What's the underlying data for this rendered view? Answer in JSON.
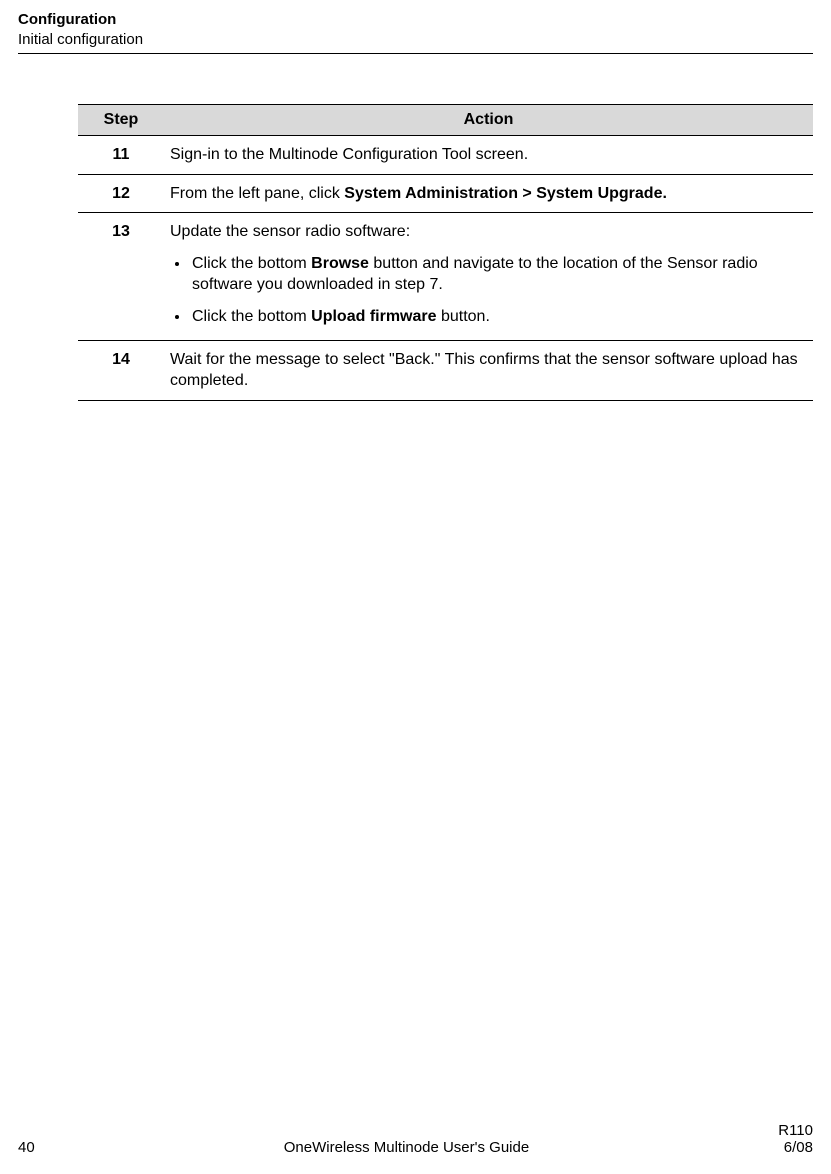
{
  "header": {
    "title": "Configuration",
    "subtitle": "Initial configuration"
  },
  "table": {
    "headers": {
      "step": "Step",
      "action": "Action"
    },
    "rows": [
      {
        "step": "11",
        "action_plain": "Sign-in to the Multinode Configuration Tool screen."
      },
      {
        "step": "12",
        "action_pre": "From the left pane, click ",
        "action_bold": "System Administration > System Upgrade."
      },
      {
        "step": "13",
        "intro": "Update the sensor radio software:",
        "bullet1_pre": "Click the bottom ",
        "bullet1_bold": "Browse",
        "bullet1_post": " button and navigate to the location of the Sensor radio software you downloaded in step 7.",
        "bullet2_pre": "Click the bottom ",
        "bullet2_bold": "Upload firmware",
        "bullet2_post": " button."
      },
      {
        "step": "14",
        "action_plain": "Wait for the message to select \"Back.\"  This confirms that the sensor software upload has completed."
      }
    ]
  },
  "footer": {
    "page": "40",
    "center": "OneWireless Multinode User's Guide",
    "right1": "R110",
    "right2": "6/08"
  }
}
